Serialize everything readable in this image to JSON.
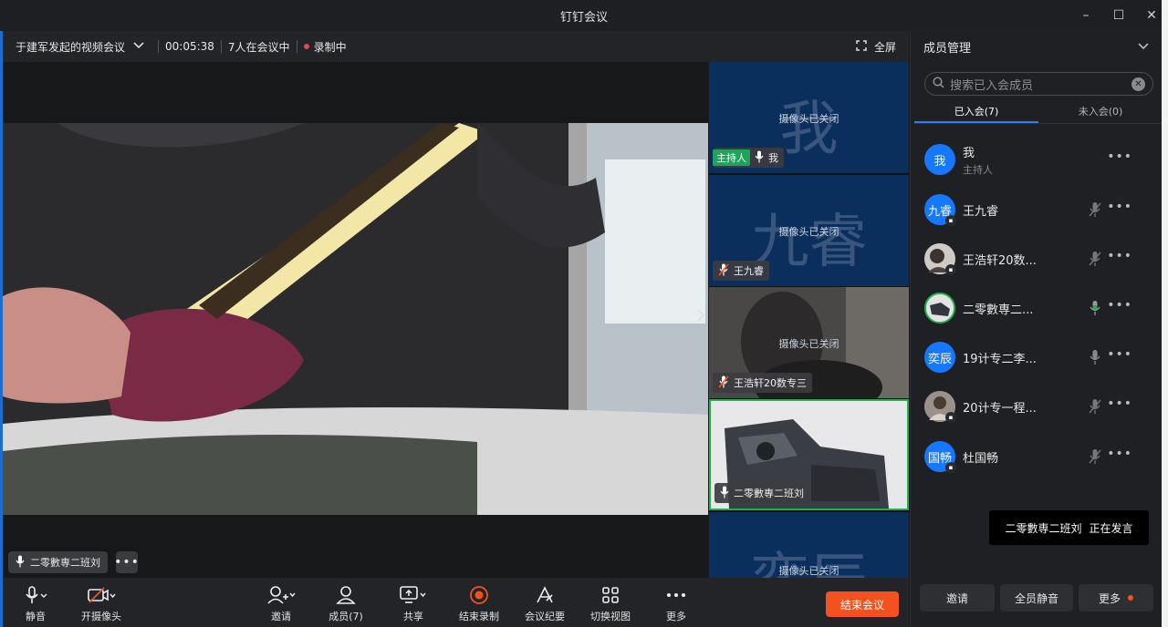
{
  "window": {
    "title": "钉钉会议",
    "minimize": "–",
    "maximize": "☐",
    "close": "✕"
  },
  "infobar": {
    "meeting_name": "于建军发起的视频会议",
    "duration": "00:05:38",
    "participants": "7人在会议中",
    "recording": "录制中",
    "fullscreen": "全屏"
  },
  "main_video": {
    "speaker": "二零數専二班刘",
    "more": "•••"
  },
  "thumbnails": [
    {
      "big": "我",
      "camera": "摄像头已关闭",
      "host": "主持人",
      "name": "我"
    },
    {
      "big": "九睿",
      "camera": "摄像头已关闭",
      "name": "王九睿"
    },
    {
      "camera": "摄像头已关闭",
      "name": "王浩轩20数专三"
    },
    {
      "name": "二零數専二班刘"
    },
    {
      "big": "奕辰",
      "camera": "摄像头已关闭"
    }
  ],
  "toolbar": {
    "mute": "静音",
    "camera": "开摄像头",
    "invite": "邀请",
    "members": "成员(7)",
    "share": "共享",
    "stop_record": "结束录制",
    "minutes": "会议纪要",
    "switch_view": "切换视图",
    "more": "更多",
    "end_meeting": "结束会议"
  },
  "panel": {
    "title": "成员管理",
    "search_placeholder": "搜索已入会成员",
    "tab_joined": "已入会(7)",
    "tab_not_joined": "未入会(0)",
    "members": [
      {
        "avatar": "我",
        "name": "我",
        "role": "主持人"
      },
      {
        "avatar": "九睿",
        "name": "王九睿"
      },
      {
        "avatar": "",
        "name": "王浩轩20数..."
      },
      {
        "avatar": "",
        "name": "二零數専二..."
      },
      {
        "avatar": "奕辰",
        "name": "19计专二李..."
      },
      {
        "avatar": "",
        "name": "20计专一程..."
      },
      {
        "avatar": "国畅",
        "name": "杜国畅"
      }
    ],
    "speaking_name": "二零數専二班刘",
    "speaking_status": "正在发言",
    "btn_invite": "邀请",
    "btn_mute_all": "全员静音",
    "btn_more": "更多"
  }
}
